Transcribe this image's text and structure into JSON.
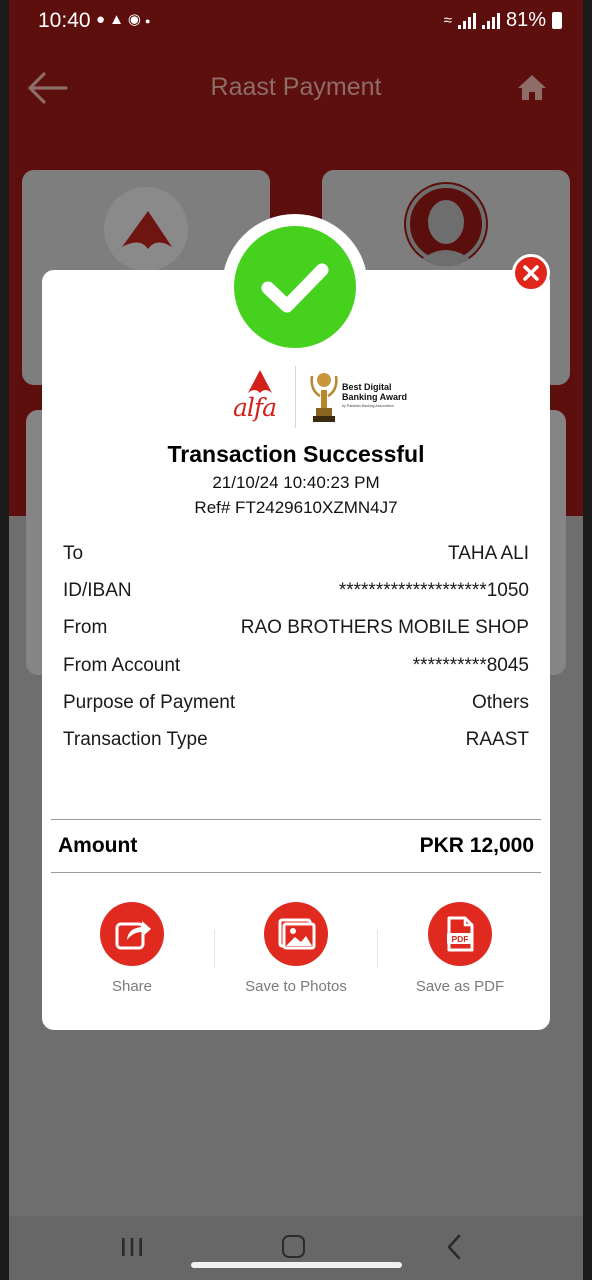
{
  "status_bar": {
    "time": "10:40",
    "notification_icons": [
      "chat-bubble-icon",
      "snapchat-icon",
      "threads-icon",
      "dot-icon"
    ],
    "battery": "81%"
  },
  "header": {
    "title": "Raast Payment",
    "back_icon": "arrow-left-icon",
    "home_icon": "home-icon"
  },
  "dialog": {
    "status_icon": "checkmark-icon",
    "close_icon": "close-icon",
    "brand_logo": "alfa",
    "award": {
      "title": "Best Digital Banking Award",
      "subtitle": "by Pakistan Banking Association"
    },
    "title": "Transaction Successful",
    "datetime": "21/10/24 10:40:23 PM",
    "reference": "Ref# FT2429610XZMN4J7",
    "details": [
      {
        "label": "To",
        "value": "TAHA ALI"
      },
      {
        "label": "ID/IBAN",
        "value": "********************1050"
      },
      {
        "label": "From",
        "value": "RAO BROTHERS MOBILE SHOP"
      },
      {
        "label": "From Account",
        "value": "**********8045"
      },
      {
        "label": "Purpose of Payment",
        "value": "Others"
      },
      {
        "label": "Transaction Type",
        "value": "RAAST"
      }
    ],
    "amount": {
      "label": "Amount",
      "value": "PKR 12,000"
    },
    "actions": [
      {
        "label": "Share",
        "icon": "share-icon"
      },
      {
        "label": "Save to Photos",
        "icon": "image-icon"
      },
      {
        "label": "Save as PDF",
        "icon": "pdf-icon"
      }
    ]
  },
  "colors": {
    "brand_red": "#e02a1f",
    "success_green": "#47d11f",
    "header_dimmed": "#5c0f0c",
    "overlay_gray": "#6b6b6b"
  },
  "system_nav": {
    "recents_icon": "recents-icon",
    "home_icon": "home-circle-icon",
    "back_icon": "chevron-left-icon"
  }
}
